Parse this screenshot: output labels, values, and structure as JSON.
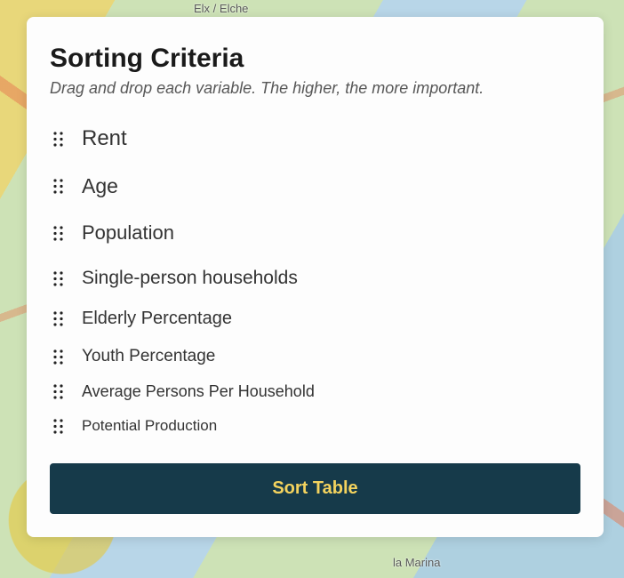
{
  "map_labels": {
    "top": "Elx / Elche",
    "bottom": "la Marina"
  },
  "card": {
    "title": "Sorting Criteria",
    "subtitle": "Drag and drop each variable. The higher, the more important."
  },
  "criteria": {
    "items": [
      "Rent",
      "Age",
      "Population",
      "Single-person households",
      "Elderly Percentage",
      "Youth Percentage",
      "Average Persons Per Household",
      "Potential Production"
    ]
  },
  "button": {
    "sort_label": "Sort Table"
  }
}
